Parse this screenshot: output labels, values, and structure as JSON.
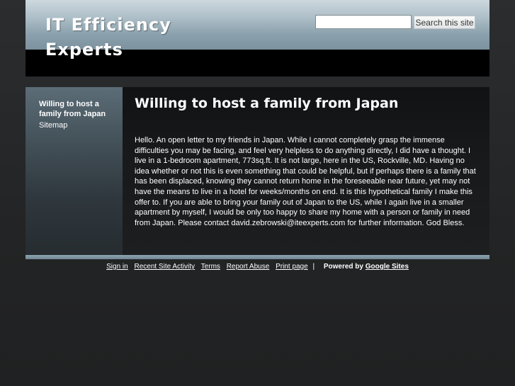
{
  "header": {
    "site_title": "IT Efficiency Experts",
    "search_placeholder": "",
    "search_value": "",
    "search_button_label": "Search this site"
  },
  "sidebar": {
    "items": [
      {
        "label": "Willing to host a family from Japan",
        "current": true
      },
      {
        "label": "Sitemap",
        "current": false
      }
    ]
  },
  "main": {
    "page_title": "Willing to host a family from Japan",
    "body": "Hello. An open letter to my friends in Japan. While I cannot completely grasp the immense difficulties you may be facing, and feel very helpless to do anything directly, I did have a thought. I live in a 1-bedroom apartment, 773sq.ft. It is not large, here in the US, Rockville, MD. Having no idea whether or not this is even something that could be helpful, but if perhaps there is a family that has been displaced, knowing they cannot return home in the foreseeable near future, yet may not have the means to live in a hotel for weeks/months on end. It is this hypothetical family I make this offer to. If you are able to bring your family out of Japan to the US, while I again live in a smaller apartment by myself, I would be only too happy to share my home with a person or family in need from Japan. Please contact david.zebrowski@iteexperts.com for further information. God Bless."
  },
  "footer": {
    "links": [
      "Sign in",
      "Recent Site Activity",
      "Terms",
      "Report Abuse",
      "Print page"
    ],
    "separator": "|",
    "powered_by_label": "Powered by",
    "powered_by_link": "Google Sites"
  },
  "colors": {
    "page_background": "#242526",
    "header_band": "#aebfc8",
    "accent_bar": "#8ea4af",
    "text": "#ffffff"
  }
}
